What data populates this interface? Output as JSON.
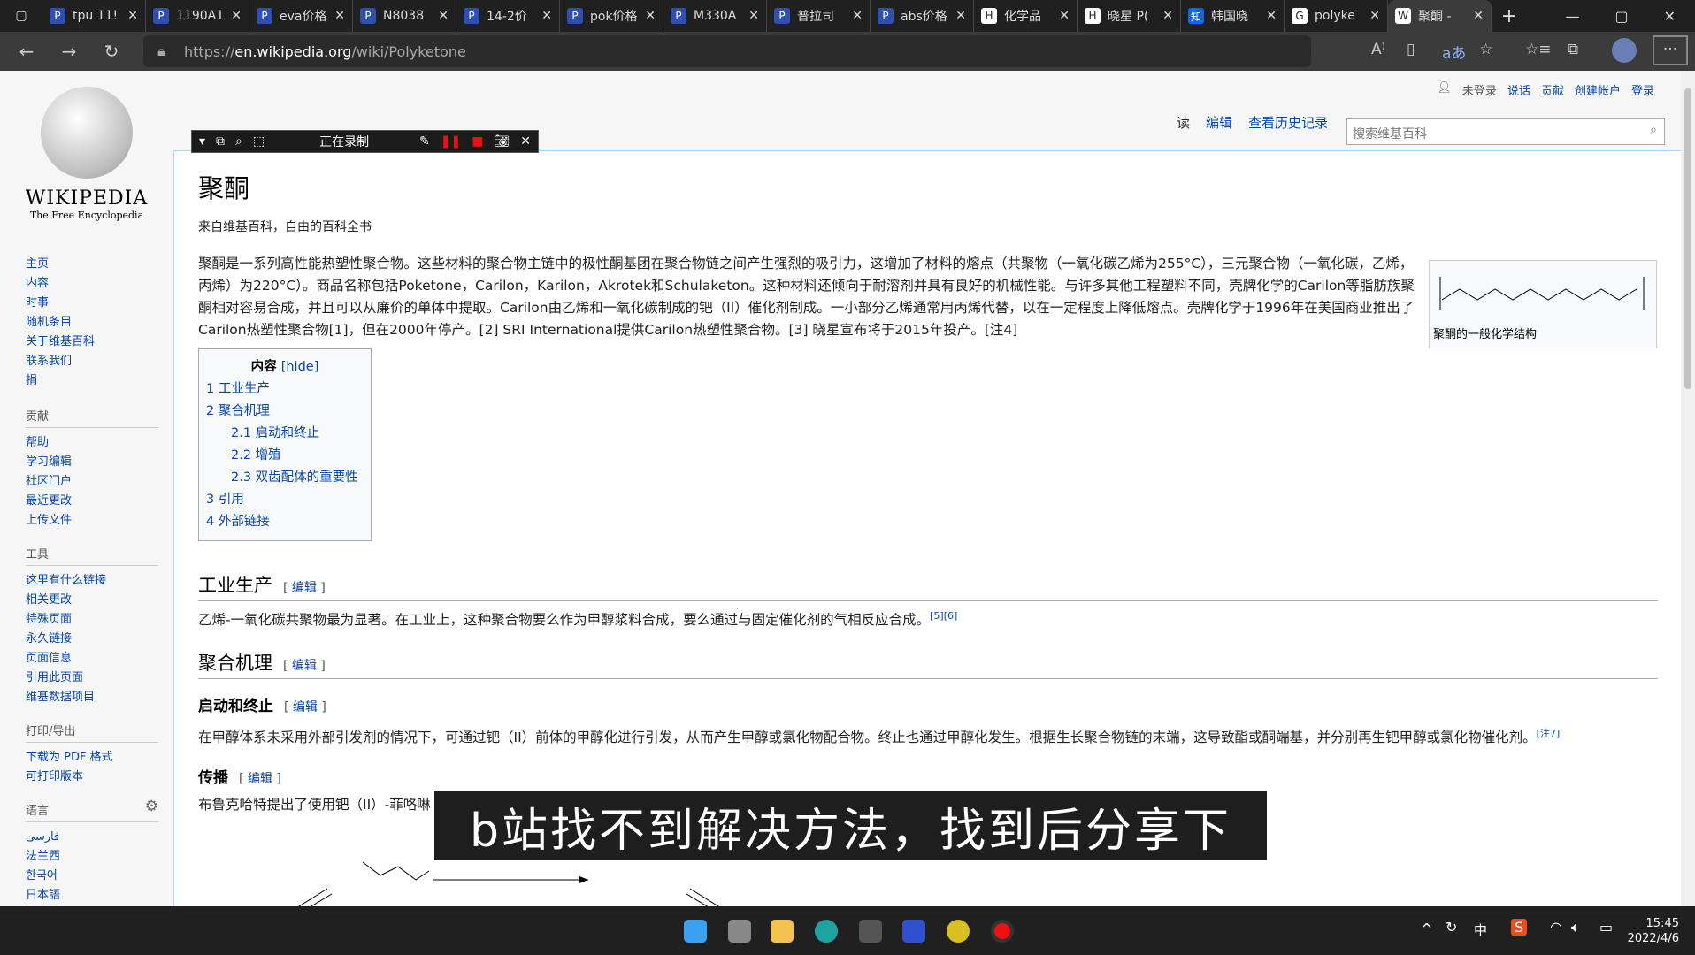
{
  "browser": {
    "tabs": [
      {
        "title": "tpu 11!",
        "icon": "P"
      },
      {
        "title": "1190A1",
        "icon": "P"
      },
      {
        "title": "eva价格",
        "icon": "P"
      },
      {
        "title": "N8038",
        "icon": "P"
      },
      {
        "title": "14-2价",
        "icon": "P"
      },
      {
        "title": "pok价格",
        "icon": "P"
      },
      {
        "title": "M330A",
        "icon": "P"
      },
      {
        "title": "普拉司",
        "icon": "P"
      },
      {
        "title": "abs价格",
        "icon": "P"
      },
      {
        "title": "化学品",
        "icon": "H"
      },
      {
        "title": "晓星 P(",
        "icon": "H"
      },
      {
        "title": "韩国晓",
        "icon": "知"
      },
      {
        "title": "polyke",
        "icon": "G"
      },
      {
        "title": "聚酮 -",
        "icon": "W"
      }
    ],
    "url_prefix": "https://",
    "url_host": "en.wikipedia.org",
    "url_path": "/wiki/Polyketone"
  },
  "recorder": {
    "status": "正在录制"
  },
  "sidebar": {
    "logo_word": "WIKIPEDIA",
    "logo_sub": "The Free Encyclopedia",
    "nav": [
      "主页",
      "内容",
      "时事",
      "随机条目",
      "关于维基百科",
      "联系我们",
      "捐"
    ],
    "contrib_title": "贡献",
    "contrib": [
      "帮助",
      "学习编辑",
      "社区门户",
      "最近更改",
      "上传文件"
    ],
    "tools_title": "工具",
    "tools": [
      "这里有什么链接",
      "相关更改",
      "特殊页面",
      "永久链接",
      "页面信息",
      "引用此页面",
      "维基数据项目"
    ],
    "print_title": "打印/导出",
    "print": [
      "下载为 PDF 格式",
      "可打印版本"
    ],
    "lang_title": "语言",
    "langs": [
      "فارسی",
      "法兰西",
      "한국어",
      "日本語"
    ]
  },
  "user": {
    "items": [
      "未登录",
      "说话",
      "贡献",
      "创建帐户",
      "登录"
    ]
  },
  "toptabs": [
    "读",
    "编辑",
    "查看历史记录"
  ],
  "search_placeholder": "搜索维基百科",
  "article": {
    "title": "聚酮",
    "tagline": "来自维基百科，自由的百科全书",
    "intro": "聚酮是一系列高性能热塑性聚合物。这些材料的聚合物主链中的极性酮基团在聚合物链之间产生强烈的吸引力，这增加了材料的熔点（共聚物（一氧化碳乙烯为255°C），三元聚合物（一氧化碳，乙烯，丙烯）为220°C）。商品名称包括Poketone，Carilon，Karilon，Akrotek和Schulaketon。这种材料还倾向于耐溶剂并具有良好的机械性能。与许多其他工程塑料不同，壳牌化学的Carilon等脂肪族聚酮相对容易合成，并且可以从廉价的单体中提取。Carilon由乙烯和一氧化碳制成的钯（II）催化剂制成。一小部分乙烯通常用丙烯代替，以在一定程度上降低熔点。壳牌化学于1996年在美国商业推出了Carilon热塑性聚合物[1]，但在2000年停产。[2] SRI International提供Carilon热塑性聚合物。[3] 晓星宣布将于2015年投产。[注4]",
    "infobox_caption": "聚酮的一般化学结构",
    "toc_title": "内容",
    "toc_hide": "[hide]",
    "toc": [
      "1 工业生产",
      "2 聚合机理",
      "2.1 启动和终止",
      "2.2 增殖",
      "2.3 双齿配体的重要性",
      "3 引用",
      "4 外部链接"
    ],
    "edit_label": "编辑",
    "s1_title": "工业生产",
    "s1_text": "乙烯-一氧化碳共聚物最为显著。在工业上，这种聚合物要么作为甲醇浆料合成，要么通过与固定催化剂的气相反应合成。",
    "s1_refs": "[5][6]",
    "s2_title": "聚合机理",
    "s21_title": "启动和终止",
    "s21_text": "在甲醇体系未采用外部引发剂的情况下，可通过钯（II）前体的甲醇化进行引发，从而产生甲醇或氯化物配合物。终止也通过甲醇化发生。根据生长聚合物链的末端，这导致酯或酮端基，并分别再生钯甲醇或氯化物催化剂。",
    "s21_ref": "[注7]",
    "s22_title": "传播",
    "s22_text": "布鲁克哈特提出了使用钯（II）-菲咯啉"
  },
  "overlay_caption": "b站找不到解决方法，找到后分享下",
  "taskbar": {
    "ime": "中",
    "time": "15:45",
    "date": "2022/4/6"
  },
  "colors": {
    "link": "#0645ad",
    "tabbar": "#202020"
  }
}
